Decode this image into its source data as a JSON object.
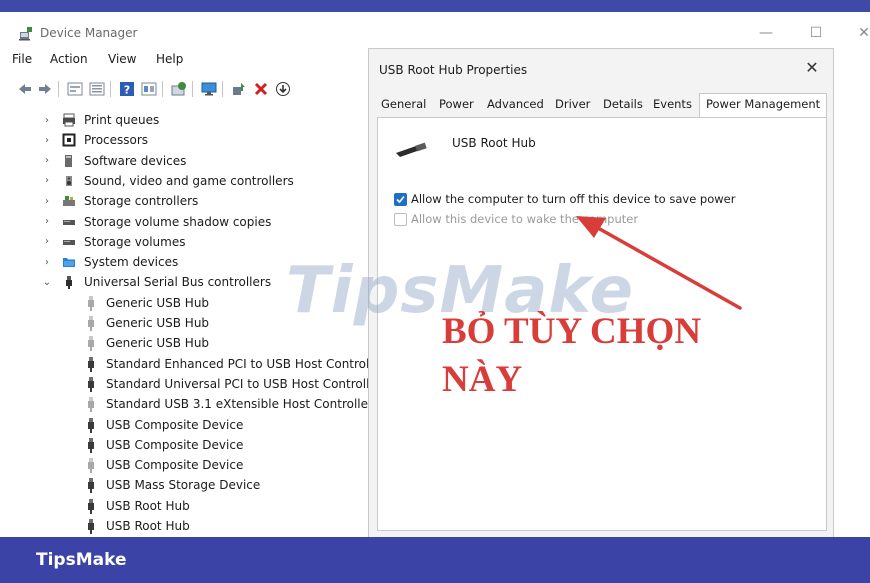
{
  "device_manager": {
    "title": "Device Manager",
    "menu": [
      "File",
      "Action",
      "View",
      "Help"
    ],
    "tree": [
      {
        "label": "Print queues",
        "icon": "printer-icon",
        "expanded": false,
        "level": 0
      },
      {
        "label": "Processors",
        "icon": "processor-icon",
        "expanded": false,
        "level": 0
      },
      {
        "label": "Software devices",
        "icon": "software-device-icon",
        "expanded": false,
        "level": 0
      },
      {
        "label": "Sound, video and game controllers",
        "icon": "speaker-icon",
        "expanded": false,
        "level": 0
      },
      {
        "label": "Storage controllers",
        "icon": "storage-controller-icon",
        "expanded": false,
        "level": 0
      },
      {
        "label": "Storage volume shadow copies",
        "icon": "drive-icon",
        "expanded": false,
        "level": 0
      },
      {
        "label": "Storage volumes",
        "icon": "drive-icon",
        "expanded": false,
        "level": 0
      },
      {
        "label": "System devices",
        "icon": "folder-icon",
        "expanded": false,
        "level": 0
      },
      {
        "label": "Universal Serial Bus controllers",
        "icon": "usb-icon",
        "expanded": true,
        "level": 0
      },
      {
        "label": "Generic USB Hub",
        "icon": "usb-plug-icon",
        "level": 1,
        "faded": true
      },
      {
        "label": "Generic USB Hub",
        "icon": "usb-plug-icon",
        "level": 1,
        "faded": true
      },
      {
        "label": "Generic USB Hub",
        "icon": "usb-plug-icon",
        "level": 1,
        "faded": true
      },
      {
        "label": "Standard Enhanced PCI to USB Host Control",
        "icon": "usb-plug-icon",
        "level": 1,
        "faded": false
      },
      {
        "label": "Standard Universal PCI to USB Host Controll",
        "icon": "usb-plug-icon",
        "level": 1,
        "faded": false
      },
      {
        "label": "Standard USB 3.1 eXtensible Host Controller",
        "icon": "usb-plug-icon",
        "level": 1,
        "faded": true
      },
      {
        "label": "USB Composite Device",
        "icon": "usb-plug-icon",
        "level": 1,
        "faded": false
      },
      {
        "label": "USB Composite Device",
        "icon": "usb-plug-icon",
        "level": 1,
        "faded": false
      },
      {
        "label": "USB Composite Device",
        "icon": "usb-plug-icon",
        "level": 1,
        "faded": true
      },
      {
        "label": "USB Mass Storage Device",
        "icon": "usb-plug-icon",
        "level": 1,
        "faded": false
      },
      {
        "label": "USB Root Hub",
        "icon": "usb-plug-icon",
        "level": 1,
        "faded": false
      },
      {
        "label": "USB Root Hub",
        "icon": "usb-plug-icon",
        "level": 1,
        "faded": false
      }
    ]
  },
  "dialog": {
    "title": "USB Root Hub Properties",
    "close_label": "✕",
    "tabs": [
      "General",
      "Power",
      "Advanced",
      "Driver",
      "Details",
      "Events",
      "Power Management"
    ],
    "active_tab": "Power Management",
    "device_name": "USB Root Hub",
    "options": [
      {
        "label": "Allow the computer to turn off this device to save power",
        "checked": true,
        "enabled": true
      },
      {
        "label": "Allow this device to wake the computer",
        "checked": false,
        "enabled": false
      }
    ]
  },
  "watermark": "TipsMake",
  "annotation": {
    "line1": "BỎ TÙY CHỌN",
    "line2": "NÀY",
    "color": "#d83d3a"
  },
  "footer": {
    "brand": "TipsMake",
    "color": "#3b44a6"
  }
}
